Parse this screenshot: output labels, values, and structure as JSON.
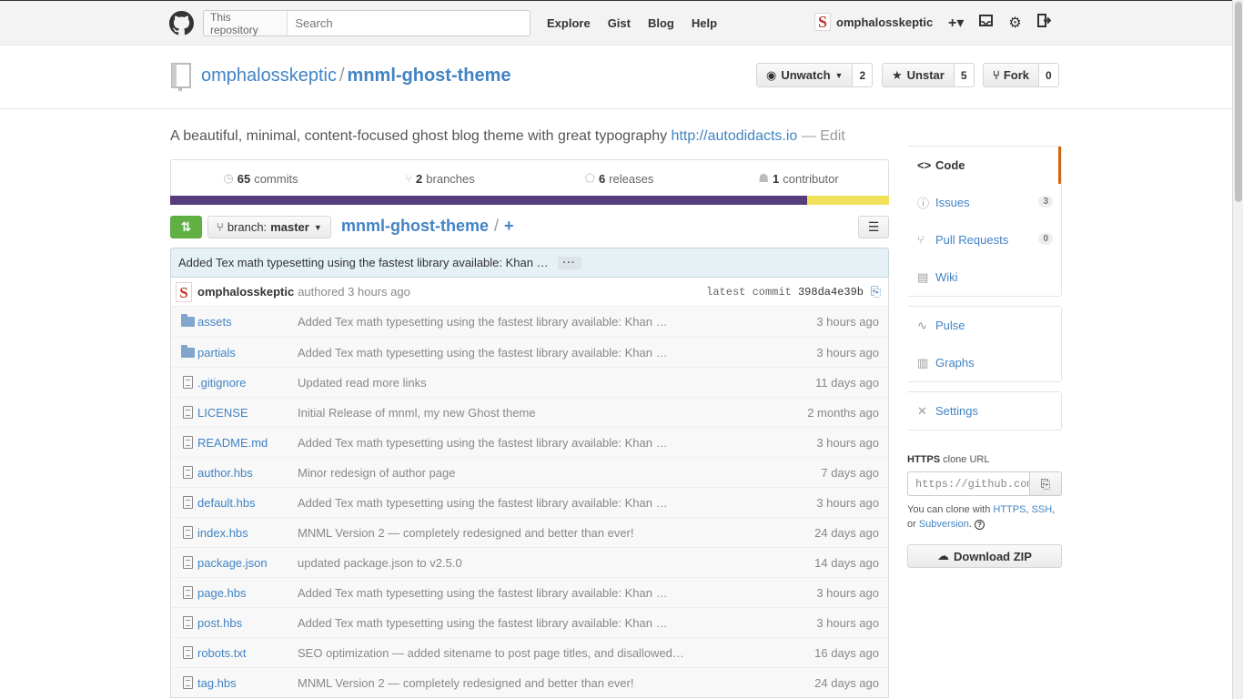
{
  "header": {
    "search_scope": "This repository",
    "search_placeholder": "Search",
    "nav": [
      "Explore",
      "Gist",
      "Blog",
      "Help"
    ],
    "avatar_letter": "S",
    "username": "omphalosskeptic"
  },
  "repo": {
    "owner": "omphalosskeptic",
    "separator": "/",
    "name": "mnml-ghost-theme",
    "watch_label": "Unwatch",
    "watch_count": "2",
    "star_label": "Unstar",
    "star_count": "5",
    "fork_label": "Fork",
    "fork_count": "0",
    "description": "A beautiful, minimal, content-focused ghost blog theme with great typography",
    "homepage": "http://autodidacts.io",
    "edit": "— Edit"
  },
  "numbers": [
    {
      "icon": "history-icon",
      "count": "65",
      "label": "commits"
    },
    {
      "icon": "branch-icon",
      "count": "2",
      "label": "branches"
    },
    {
      "icon": "tag-icon",
      "count": "6",
      "label": "releases"
    },
    {
      "icon": "organization-icon",
      "count": "1",
      "label": "contributor"
    }
  ],
  "languages": {
    "colors": [
      "#563d7c",
      "#f1e05a"
    ]
  },
  "file_nav": {
    "branch_prefix": "branch:",
    "branch": "master",
    "breadcrumb_repo": "mnml-ghost-theme",
    "breadcrumb_sep": "/",
    "breadcrumb_plus": "+"
  },
  "commit": {
    "message": "Added Tex math typesetting using the fastest library available: Khan …",
    "more": "···",
    "author": "omphalosskeptic",
    "authored": "authored 3 hours ago",
    "latest_label": "latest commit",
    "sha": "398da4e39b"
  },
  "files": [
    {
      "type": "dir",
      "name": "assets",
      "message": "Added Tex math typesetting using the fastest library available: Khan …",
      "age": "3 hours ago"
    },
    {
      "type": "dir",
      "name": "partials",
      "message": "Added Tex math typesetting using the fastest library available: Khan …",
      "age": "3 hours ago"
    },
    {
      "type": "file",
      "name": ".gitignore",
      "message": "Updated read more links",
      "age": "11 days ago"
    },
    {
      "type": "file",
      "name": "LICENSE",
      "message": "Initial Release of mnml, my new Ghost theme",
      "age": "2 months ago"
    },
    {
      "type": "file",
      "name": "README.md",
      "message": "Added Tex math typesetting using the fastest library available: Khan …",
      "age": "3 hours ago"
    },
    {
      "type": "file",
      "name": "author.hbs",
      "message": "Minor redesign of author page",
      "age": "7 days ago"
    },
    {
      "type": "file",
      "name": "default.hbs",
      "message": "Added Tex math typesetting using the fastest library available: Khan …",
      "age": "3 hours ago"
    },
    {
      "type": "file",
      "name": "index.hbs",
      "message": "MNML Version 2 — completely redesigned and better than ever!",
      "age": "24 days ago"
    },
    {
      "type": "file",
      "name": "package.json",
      "message": "updated package.json to v2.5.0",
      "age": "14 days ago"
    },
    {
      "type": "file",
      "name": "page.hbs",
      "message": "Added Tex math typesetting using the fastest library available: Khan …",
      "age": "3 hours ago"
    },
    {
      "type": "file",
      "name": "post.hbs",
      "message": "Added Tex math typesetting using the fastest library available: Khan …",
      "age": "3 hours ago"
    },
    {
      "type": "file",
      "name": "robots.txt",
      "message": "SEO optimization — added sitename to post page titles, and disallowed…",
      "age": "16 days ago"
    },
    {
      "type": "file",
      "name": "tag.hbs",
      "message": "MNML Version 2 — completely redesigned and better than ever!",
      "age": "24 days ago"
    }
  ],
  "sidebar": {
    "group1": [
      {
        "icon": "code-icon",
        "label": "Code",
        "selected": true
      },
      {
        "icon": "issues-icon",
        "label": "Issues",
        "badge": "3"
      },
      {
        "icon": "pull-request-icon",
        "label": "Pull Requests",
        "badge": "0"
      },
      {
        "icon": "wiki-icon",
        "label": "Wiki"
      }
    ],
    "group2": [
      {
        "icon": "pulse-icon",
        "label": "Pulse"
      },
      {
        "icon": "graph-icon",
        "label": "Graphs"
      }
    ],
    "group3": [
      {
        "icon": "tools-icon",
        "label": "Settings"
      }
    ],
    "clone": {
      "protocol": "HTTPS",
      "label": "clone URL",
      "url": "https://github.com/omphalosskeptic/mnml-ghost-theme.git",
      "help_prefix": "You can clone with",
      "https": "HTTPS",
      "ssh": "SSH",
      "or": "or",
      "svn": "Subversion",
      "download": "Download ZIP"
    }
  }
}
